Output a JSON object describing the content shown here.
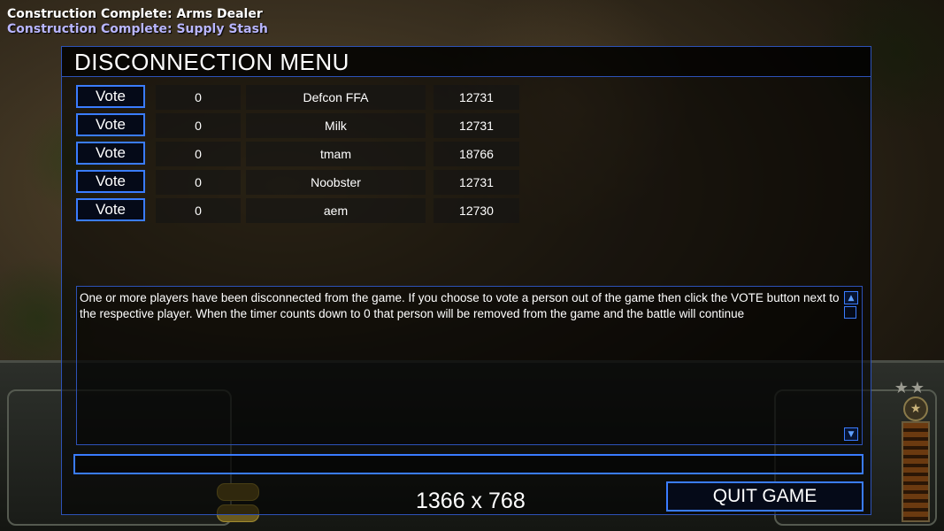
{
  "notifications": [
    "Construction Complete: Arms Dealer",
    "Construction Complete: Supply Stash"
  ],
  "dialog": {
    "title": "DISCONNECTION MENU",
    "vote_label": "Vote",
    "players": [
      {
        "count": "0",
        "name": "Defcon FFA",
        "ping": "12731"
      },
      {
        "count": "0",
        "name": "Milk",
        "ping": "12731"
      },
      {
        "count": "0",
        "name": "tmam",
        "ping": "18766"
      },
      {
        "count": "0",
        "name": "Noobster",
        "ping": "12731"
      },
      {
        "count": "0",
        "name": "aem",
        "ping": "12730"
      }
    ],
    "message": "One or more players have been disconnected from the game. If you choose to vote a person out of the game then click the VOTE button next to the respective player. When the timer counts down to 0 that person will be removed from the game and the battle will continue",
    "chat_value": "",
    "quit_label": "QUIT GAME",
    "resolution": "1366 x 768"
  },
  "colors": {
    "accent_border": "#3a7cff",
    "notification_secondary": "#b9b6ff"
  }
}
